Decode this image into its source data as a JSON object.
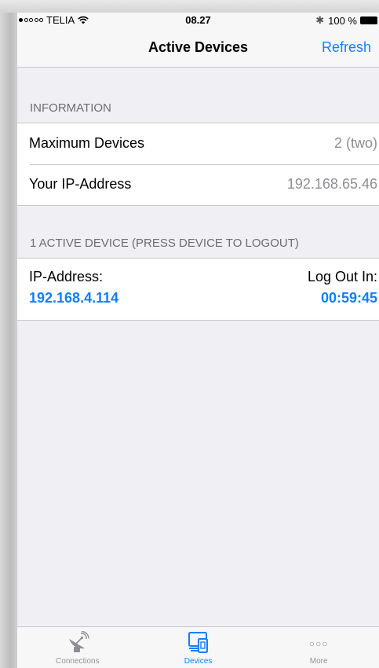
{
  "status_bar": {
    "carrier": "TELIA",
    "time": "08.27",
    "battery": "100 %"
  },
  "nav": {
    "title": "Active Devices",
    "refresh_label": "Refresh"
  },
  "information": {
    "header": "INFORMATION",
    "rows": [
      {
        "label": "Maximum Devices",
        "value": "2 (two)"
      },
      {
        "label": "Your IP-Address",
        "value": "192.168.65.46"
      }
    ]
  },
  "active": {
    "header": "1 ACTIVE DEVICE (PRESS DEVICE TO LOGOUT)",
    "devices": [
      {
        "ip_caption": "IP-Address:",
        "ip": "192.168.4.114",
        "logout_caption": "Log Out In:",
        "logout": "00:59:45"
      }
    ]
  },
  "tabs": [
    {
      "label": "Connections",
      "icon": "satellite-dish-icon",
      "active": false
    },
    {
      "label": "Devices",
      "icon": "devices-icon",
      "active": true
    },
    {
      "label": "More",
      "icon": "more-dots-icon",
      "active": false
    }
  ],
  "colors": {
    "accent": "#147efb",
    "secondary_text": "#8e8e93",
    "background": "#efeff4"
  }
}
